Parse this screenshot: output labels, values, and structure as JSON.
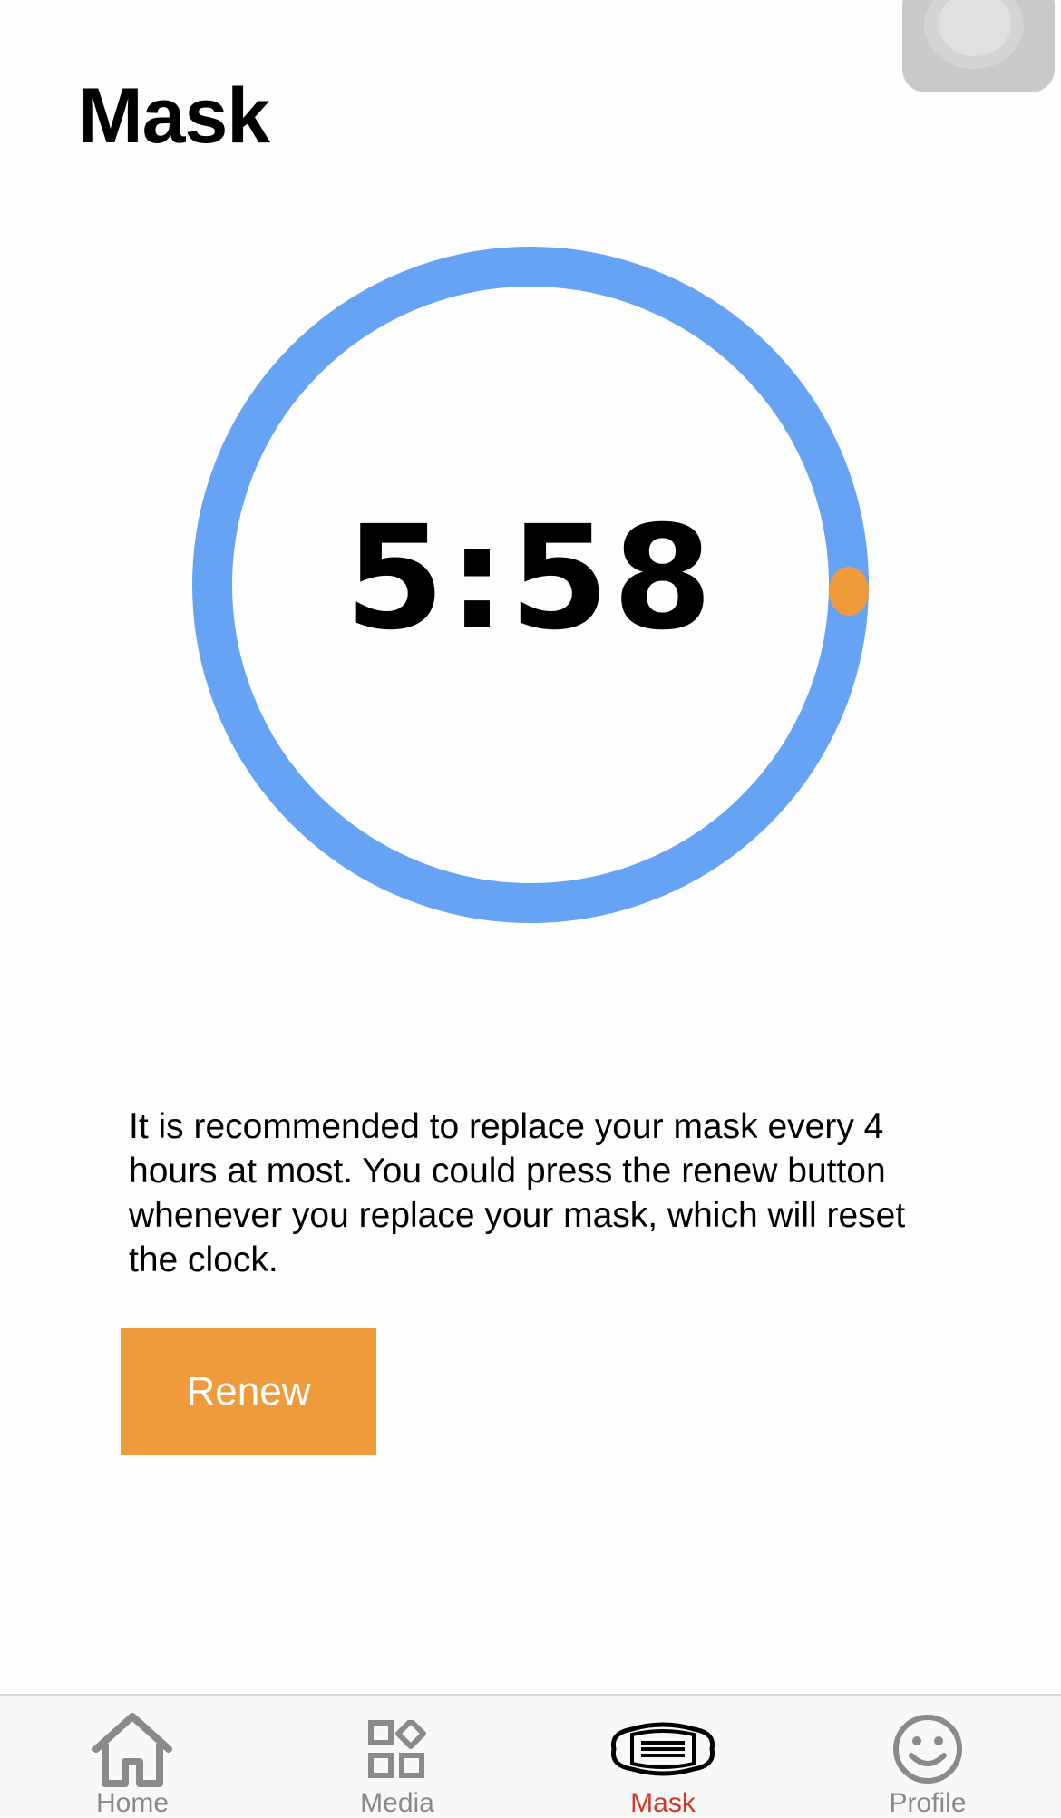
{
  "header": {
    "title": "Mask"
  },
  "timer": {
    "display": "5:58",
    "ring_color": "#66a3f5",
    "indicator_color": "#ef9b3b"
  },
  "info": {
    "description": "It is recommended to replace your mask  every 4 hours at most. You could press the renew button whenever you replace your mask, which will reset the clock."
  },
  "actions": {
    "renew_label": "Renew",
    "renew_color": "#ef9b3b"
  },
  "tab_bar": {
    "active_color": "#d4342a",
    "inactive_color": "#8a8a8a",
    "items": [
      {
        "label": "Home",
        "icon": "home-icon"
      },
      {
        "label": "Media",
        "icon": "media-icon"
      },
      {
        "label": "Mask",
        "icon": "mask-icon",
        "active": true
      },
      {
        "label": "Profile",
        "icon": "smiley-icon"
      }
    ]
  }
}
